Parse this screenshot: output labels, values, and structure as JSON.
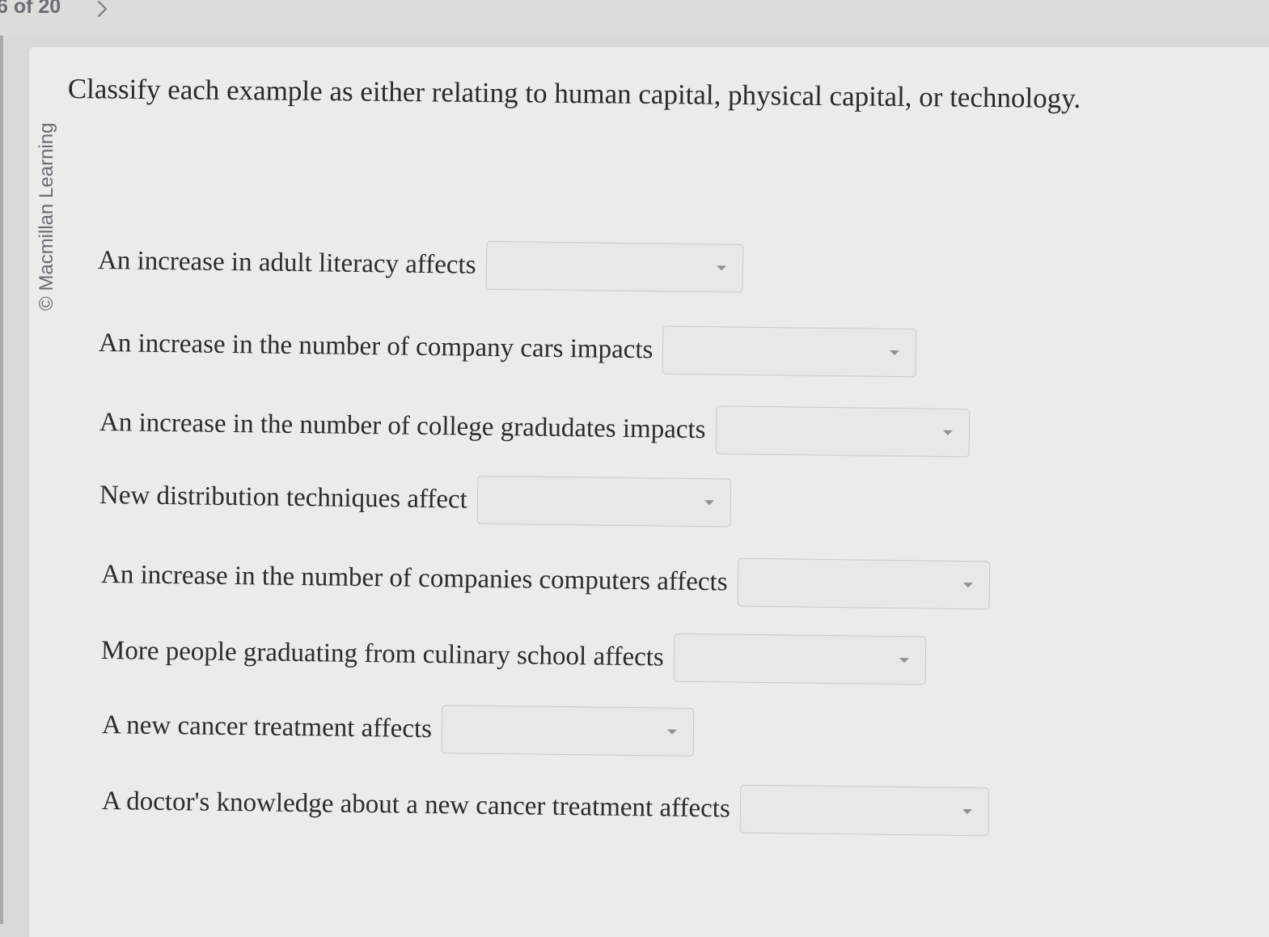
{
  "nav": {
    "counter": "6 of 20",
    "next_icon": "chevron-right-icon"
  },
  "sidebar": {
    "credit": "© Macmillan Learning"
  },
  "question": {
    "title": "Classify each example as either relating to human capital, physical capital, or technology.",
    "items": [
      {
        "prompt": "An increase in adult literacy affects",
        "selected": ""
      },
      {
        "prompt": "An increase in the number of company cars impacts",
        "selected": ""
      },
      {
        "prompt": "An increase in the number of college gradudates impacts",
        "selected": ""
      },
      {
        "prompt": "New distribution techniques affect",
        "selected": ""
      },
      {
        "prompt": "An increase in the number of companies computers affects",
        "selected": ""
      },
      {
        "prompt": "More people graduating from culinary school affects",
        "selected": ""
      },
      {
        "prompt": "A new cancer treatment affects",
        "selected": ""
      },
      {
        "prompt": "A doctor's knowledge about a new cancer treatment affects",
        "selected": ""
      }
    ]
  },
  "colors": {
    "background": "#d9d9d7",
    "card": "#ebebe9",
    "text": "#2b2b2b",
    "muted": "#6a6e74",
    "dropdown_border": "#c9c9c6"
  }
}
